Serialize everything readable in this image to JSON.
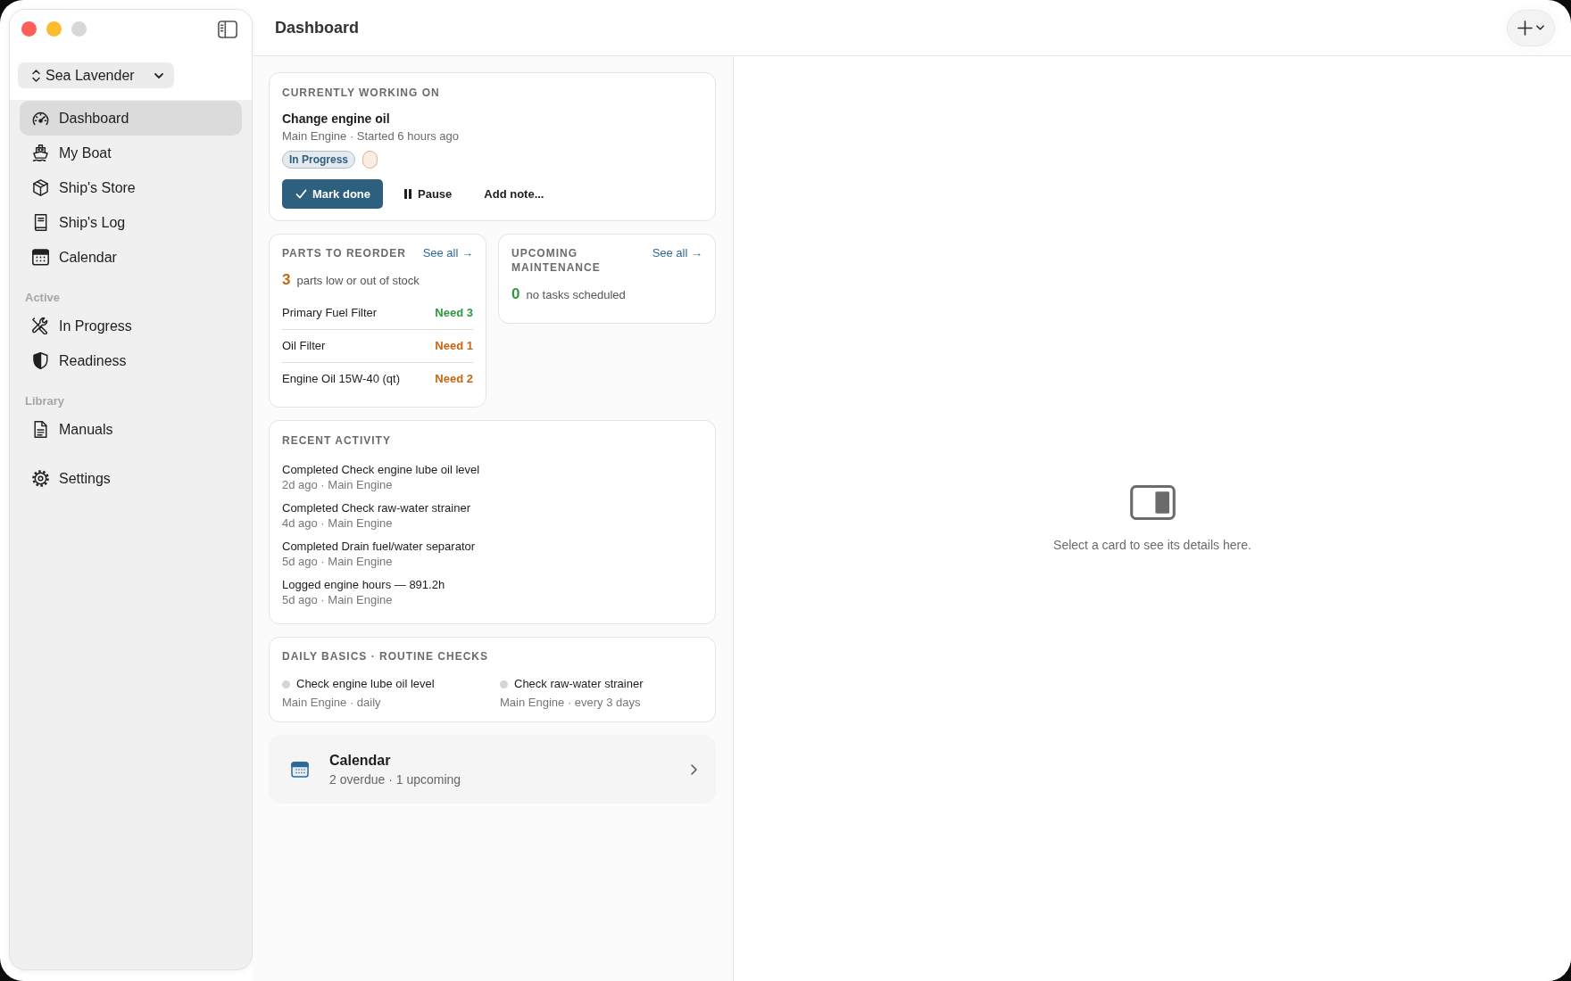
{
  "toolbar": {
    "title": "Dashboard"
  },
  "sidebar": {
    "vessel": "Sea Lavender",
    "groups": [
      {
        "items": [
          {
            "label": "Dashboard",
            "selected": true
          },
          {
            "label": "My Boat",
            "selected": false
          },
          {
            "label": "Ship's Store",
            "selected": false
          },
          {
            "label": "Ship's Log",
            "selected": false
          },
          {
            "label": "Calendar",
            "selected": false
          }
        ]
      },
      {
        "heading": "Active",
        "items": [
          {
            "label": "In Progress",
            "selected": false
          },
          {
            "label": "Readiness",
            "selected": false
          }
        ]
      },
      {
        "heading": "Library",
        "items": [
          {
            "label": "Manuals",
            "selected": false
          }
        ]
      },
      {
        "items": [
          {
            "label": "Settings",
            "selected": false
          }
        ]
      }
    ]
  },
  "current_task": {
    "heading": "CURRENTLY WORKING ON",
    "title": "Change engine oil",
    "meta": "Main Engine · Started 6 hours ago",
    "tags": [
      {
        "label": "In Progress",
        "color": "#2e5e7e"
      },
      {
        "color": "#e6ab80"
      }
    ],
    "actions": [
      {
        "label": "Mark done",
        "kind": "primary"
      },
      {
        "label": "Pause",
        "kind": "plain"
      },
      {
        "label": "Add note...",
        "kind": "plain"
      }
    ]
  },
  "overview": [
    {
      "heading": "PARTS TO REORDER",
      "link": "See all →",
      "count": "3",
      "summary": "parts low or out of stock",
      "color": "#c7660f",
      "rows": [
        {
          "name": "Primary Fuel Filter",
          "need": "Need 3",
          "color": "#2f9a3e"
        },
        {
          "name": "Oil Filter",
          "need": "Need 1",
          "color": "#c7660f"
        },
        {
          "name": "Engine Oil 15W-40 (qt)",
          "need": "Need 2",
          "color": "#c7660f"
        }
      ]
    },
    {
      "heading": "UPCOMING MAINTENANCE",
      "link": "See all →",
      "count": "0",
      "summary": "no tasks scheduled",
      "color": "#2f9a3e"
    }
  ],
  "recent_activity": {
    "heading": "RECENT ACTIVITY",
    "items": [
      {
        "title": "Completed Check engine lube oil level",
        "meta": "2d ago · Main Engine"
      },
      {
        "title": "Completed Check raw-water strainer",
        "meta": "4d ago · Main Engine"
      },
      {
        "title": "Completed Drain fuel/water separator",
        "meta": "5d ago · Main Engine"
      },
      {
        "title": "Logged engine hours — 891.2h",
        "meta": "5d ago · Main Engine"
      }
    ]
  },
  "routine_checks": {
    "heading": "DAILY BASICS · ROUTINE CHECKS",
    "items": [
      {
        "title": "Check engine lube oil level",
        "meta": "Main Engine · daily"
      },
      {
        "title": "Check raw-water strainer",
        "meta": "Main Engine · every 3 days"
      }
    ]
  },
  "calendar_card": {
    "title": "Calendar",
    "meta": "2 overdue · 1 upcoming"
  },
  "detail_pane": {
    "message": "Select a card to see its details here."
  }
}
